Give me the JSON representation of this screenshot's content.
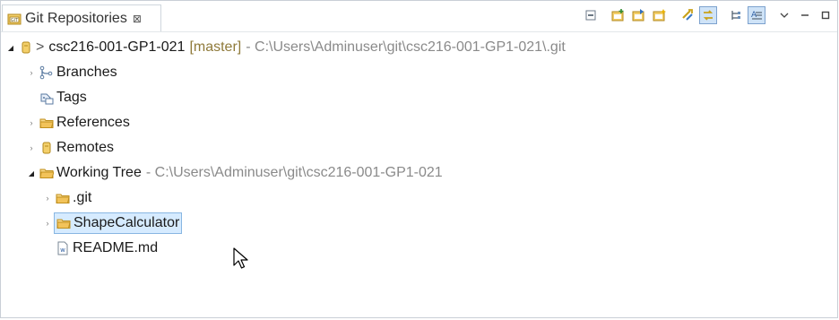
{
  "tab": {
    "title": "Git Repositories",
    "close_glyph": "⊠"
  },
  "toolbar": {
    "buttons": [
      {
        "name": "collapse-all-icon"
      },
      {
        "name": "add-existing-repo-icon"
      },
      {
        "name": "clone-repo-icon"
      },
      {
        "name": "create-repo-icon"
      },
      {
        "name": "refresh-icon"
      },
      {
        "name": "link-with-selection-icon",
        "pressed": true
      },
      {
        "name": "hierarchical-branch-icon"
      },
      {
        "name": "show-details-icon",
        "pressed": true
      },
      {
        "name": "view-menu-icon"
      },
      {
        "name": "minimize-icon"
      },
      {
        "name": "maximize-icon"
      }
    ]
  },
  "tree": {
    "repo": {
      "prefix": ">",
      "name": "csc216-001-GP1-021",
      "branch": "[master]",
      "path": "- C:\\Users\\Adminuser\\git\\csc216-001-GP1-021\\.git"
    },
    "branches": "Branches",
    "tags": "Tags",
    "references": "References",
    "remotes": "Remotes",
    "working_tree": {
      "label": "Working Tree",
      "path": "- C:\\Users\\Adminuser\\git\\csc216-001-GP1-021"
    },
    "git_folder": ".git",
    "shape_calculator": "ShapeCalculator",
    "readme": "README.md"
  },
  "colors": {
    "accent": "#cfe3f7",
    "selection_bg": "#d6ebff",
    "selection_border": "#88b6e2",
    "folder": "#e8b33c",
    "branch_decoration": "#8f7a3a",
    "path_decoration": "#8a8a8a"
  }
}
